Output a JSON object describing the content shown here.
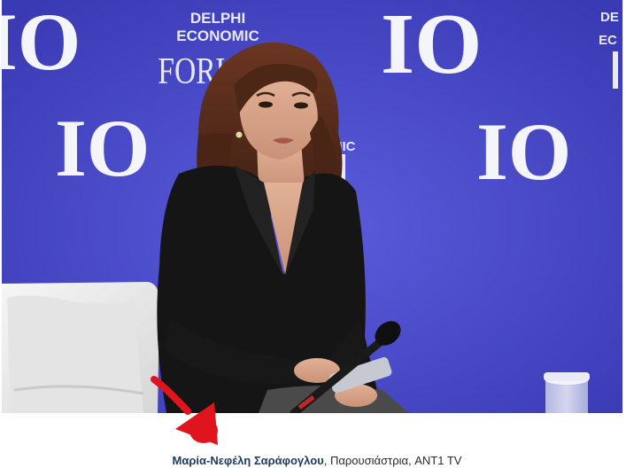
{
  "photo": {
    "backdrop_logo_text": "IO",
    "event_logo_lines": [
      "DELPHI",
      "ECONOMIC",
      "FORUM"
    ],
    "colors": {
      "backdrop": "#4444c4",
      "jacket": "#151515",
      "hair": "#5a2e1c",
      "skin": "#d9a78b",
      "chair": "#ececec",
      "arrow": "#e0141c"
    }
  },
  "caption": {
    "name": "Μαρία-Νεφέλη Σαράφογλου",
    "separator": ", ",
    "role": "Παρουσιάστρια, ANT1 TV"
  },
  "annotation": {
    "icon": "red-arrow-icon"
  }
}
